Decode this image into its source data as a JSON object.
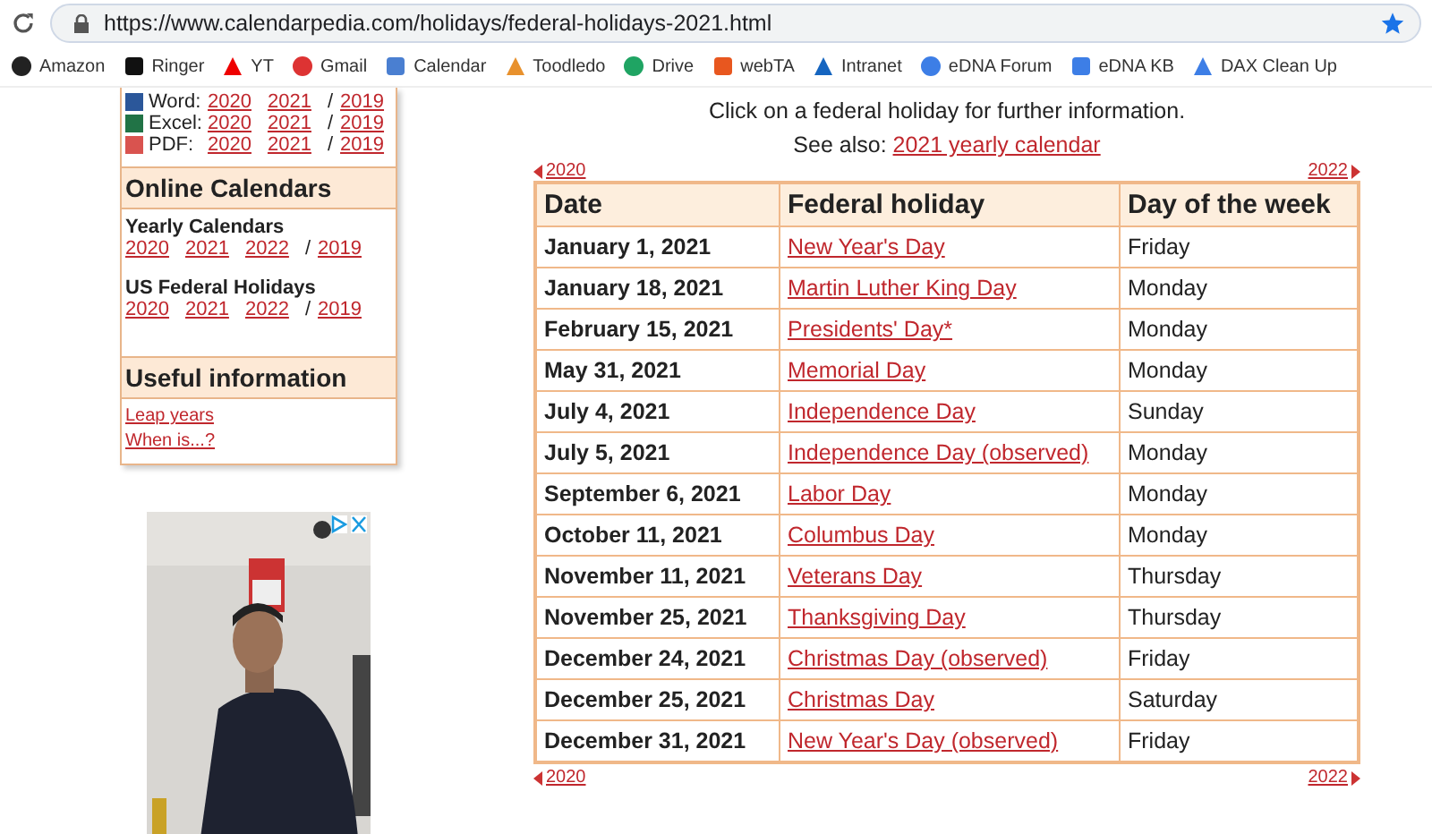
{
  "browser": {
    "url": "https://www.calendarpedia.com/holidays/federal-holidays-2021.html",
    "bookmarks": [
      "Amazon",
      "Ringer",
      "YT",
      "Gmail",
      "Calendar",
      "Toodledo",
      "Drive",
      "webTA",
      "Intranet",
      "eDNA Forum",
      "eDNA KB",
      "DAX Clean Up"
    ]
  },
  "sidebar": {
    "downloads": [
      {
        "label": "Word:",
        "links": [
          "2020",
          "2021",
          "2019"
        ],
        "separator": "/"
      },
      {
        "label": "Excel:",
        "links": [
          "2020",
          "2021",
          "2019"
        ],
        "separator": "/"
      },
      {
        "label": "PDF:",
        "links": [
          "2020",
          "2021",
          "2019"
        ],
        "separator": "/"
      }
    ],
    "sections": [
      {
        "heading": "Online Calendars",
        "groups": [
          {
            "title": "Yearly Calendars",
            "links": [
              "2020",
              "2021",
              "2022",
              "2019"
            ],
            "separator": "/"
          },
          {
            "title": "US Federal Holidays",
            "links": [
              "2020",
              "2021",
              "2022",
              "2019"
            ],
            "separator": "/"
          }
        ]
      },
      {
        "heading": "Useful information",
        "links": [
          "Leap years",
          "When is...?"
        ]
      }
    ]
  },
  "main": {
    "intro": "Click on a federal holiday for further information.",
    "see_also_label": "See also:",
    "see_also_link": "2021 yearly calendar",
    "prev_year": "2020",
    "next_year": "2022",
    "columns": [
      "Date",
      "Federal holiday",
      "Day of the week"
    ],
    "rows": [
      {
        "date": "January 1, 2021",
        "holiday": "New Year's Day",
        "day": "Friday"
      },
      {
        "date": "January 18, 2021",
        "holiday": "Martin Luther King Day",
        "day": "Monday"
      },
      {
        "date": "February 15, 2021",
        "holiday": "Presidents' Day*",
        "day": "Monday"
      },
      {
        "date": "May 31, 2021",
        "holiday": "Memorial Day",
        "day": "Monday"
      },
      {
        "date": "July 4, 2021",
        "holiday": "Independence Day",
        "day": "Sunday"
      },
      {
        "date": "July 5, 2021",
        "holiday": "Independence Day (observed)",
        "day": "Monday"
      },
      {
        "date": "September 6, 2021",
        "holiday": "Labor Day",
        "day": "Monday"
      },
      {
        "date": "October 11, 2021",
        "holiday": "Columbus Day",
        "day": "Monday"
      },
      {
        "date": "November 11, 2021",
        "holiday": "Veterans Day",
        "day": "Thursday"
      },
      {
        "date": "November 25, 2021",
        "holiday": "Thanksgiving Day",
        "day": "Thursday"
      },
      {
        "date": "December 24, 2021",
        "holiday": "Christmas Day (observed)",
        "day": "Friday"
      },
      {
        "date": "December 25, 2021",
        "holiday": "Christmas Day",
        "day": "Saturday"
      },
      {
        "date": "December 31, 2021",
        "holiday": "New Year's Day (observed)",
        "day": "Friday"
      }
    ],
    "bottom_prev_year": "2020",
    "bottom_next_year": "2022"
  }
}
